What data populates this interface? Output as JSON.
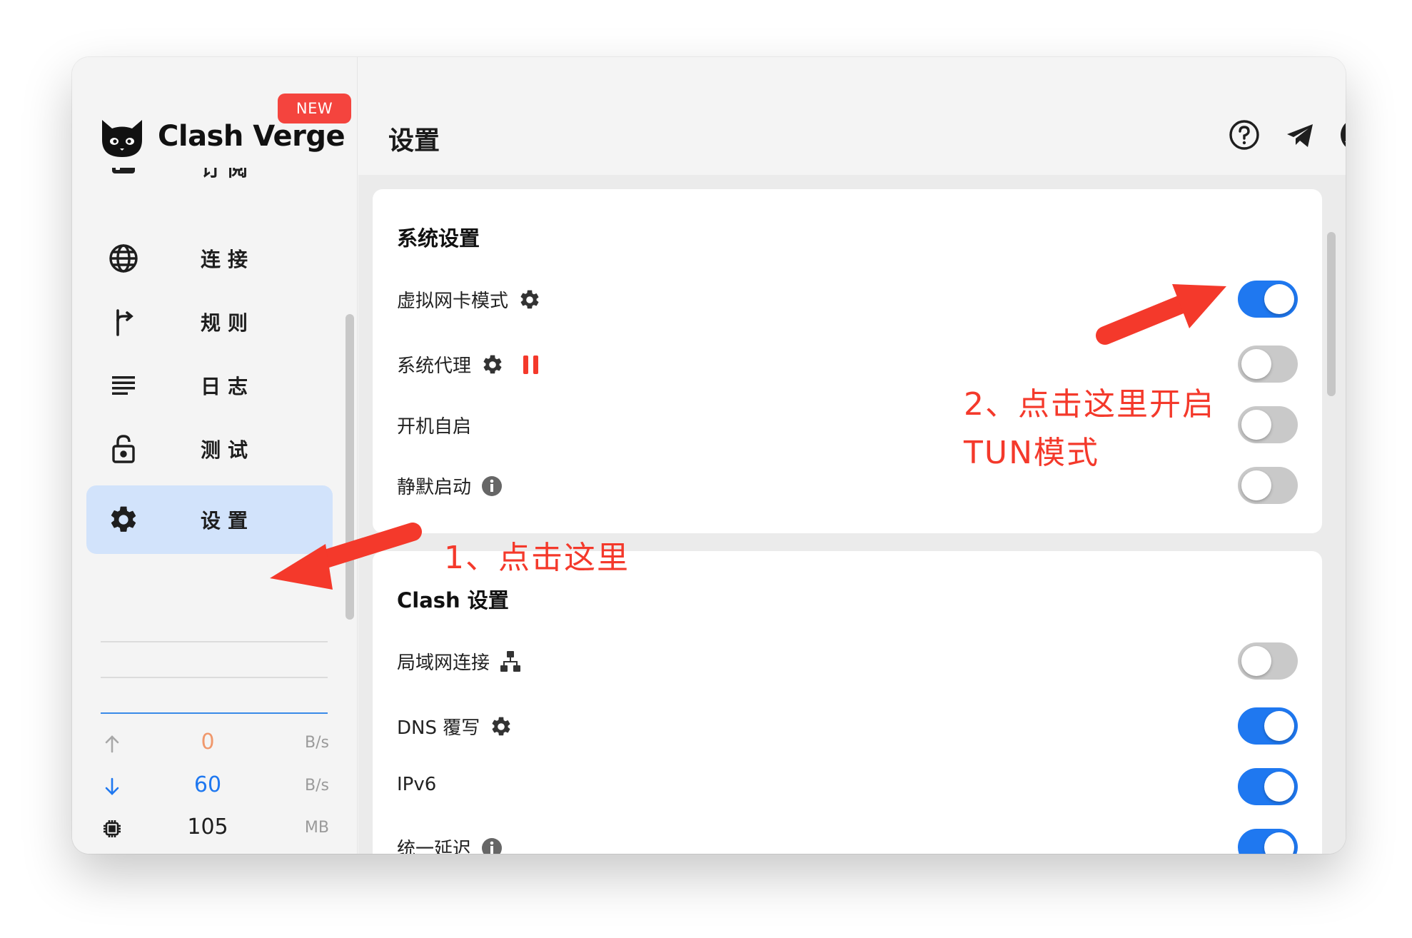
{
  "app": {
    "name": "Clash Verge",
    "badge": "NEW"
  },
  "sidebar": {
    "items": [
      {
        "label": "订阅",
        "icon": "profiles-icon"
      },
      {
        "label": "连接",
        "icon": "globe-icon"
      },
      {
        "label": "规则",
        "icon": "rules-fork-icon"
      },
      {
        "label": "日志",
        "icon": "logs-list-icon"
      },
      {
        "label": "测试",
        "icon": "lock-open-icon"
      },
      {
        "label": "设置",
        "icon": "gear-icon",
        "active": true
      }
    ]
  },
  "traffic": {
    "upload": {
      "value": "0",
      "unit": "B/s",
      "color": "#f0986c"
    },
    "download": {
      "value": "60",
      "unit": "B/s",
      "color": "#1f78f0"
    },
    "memory": {
      "value": "105",
      "unit": "MB"
    }
  },
  "header": {
    "title": "设置",
    "icons": [
      "help-icon",
      "telegram-icon",
      "github-icon"
    ]
  },
  "system_settings": {
    "title": "系统设置",
    "rows": [
      {
        "label": "虚拟网卡模式",
        "icon": "gear-icon",
        "enabled": true
      },
      {
        "label": "系统代理",
        "icon": "gear-icon",
        "extra": "pause-icon",
        "enabled": false
      },
      {
        "label": "开机自启",
        "enabled": false
      },
      {
        "label": "静默启动",
        "icon": "info-icon",
        "enabled": false
      }
    ]
  },
  "clash_settings": {
    "title": "Clash 设置",
    "rows": [
      {
        "label": "局域网连接",
        "icon": "network-icon",
        "enabled": false
      },
      {
        "label": "DNS 覆写",
        "icon": "gear-icon",
        "enabled": true
      },
      {
        "label": "IPv6",
        "enabled": true
      },
      {
        "label": "统一延迟",
        "icon": "info-icon",
        "enabled": true
      }
    ]
  },
  "annotations": {
    "step1": "1、点击这里",
    "step2_line1": "2、点击这里开启",
    "step2_line2": "TUN模式",
    "color": "#f4392b"
  },
  "colors": {
    "accent": "#1f78f0",
    "active_nav": "#d2e3fb",
    "toggle_off": "#c9c9c9",
    "pause": "#f4392b"
  }
}
